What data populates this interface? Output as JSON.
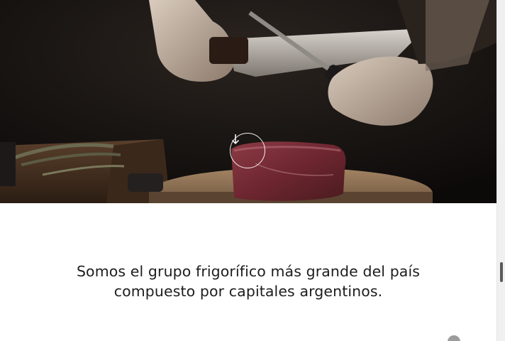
{
  "hero": {
    "scroll_icon": "arrow-down-icon"
  },
  "intro": {
    "heading_line1": "Somos el grupo frigorífico más grande del país",
    "heading_line2": "compuesto por capitales argentinos."
  },
  "colors": {
    "hero_background": "#120f0d",
    "heading_text": "#1d1d1d",
    "page_background": "#ffffff"
  }
}
